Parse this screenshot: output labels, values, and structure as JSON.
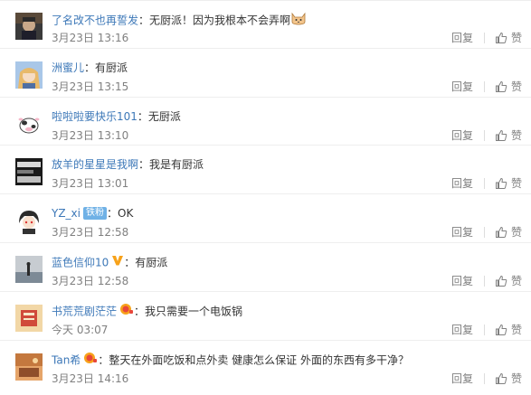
{
  "comments": [
    {
      "username": "了名改不也再誓发",
      "separator": "：",
      "text": "无厨派！因为我根本不会弄啊",
      "time": "3月23日 13:16",
      "reply_label": "回复",
      "like_label": "赞",
      "avatar_icon": "avatar-dark-portrait",
      "emoji": "cat-emoji"
    },
    {
      "username": "洲蜜儿",
      "separator": "：",
      "text": "有厨派",
      "time": "3月23日 13:15",
      "reply_label": "回复",
      "like_label": "赞",
      "avatar_icon": "avatar-anime-girl"
    },
    {
      "username": "啦啦啦要快乐101",
      "separator": "：",
      "text": "无厨派",
      "time": "3月23日 13:10",
      "reply_label": "回复",
      "like_label": "赞",
      "avatar_icon": "avatar-cow-cartoon"
    },
    {
      "username": "放羊的星星是我啊",
      "separator": "：",
      "text": "我是有厨派",
      "time": "3月23日 13:01",
      "reply_label": "回复",
      "like_label": "赞",
      "avatar_icon": "avatar-black-white-photo"
    },
    {
      "username": "YZ_xi",
      "badge": "铁粉",
      "separator": "：",
      "text": "OK",
      "time": "3月23日 12:58",
      "reply_label": "回复",
      "like_label": "赞",
      "avatar_icon": "avatar-anime-boy"
    },
    {
      "username": "蓝色信仰10",
      "vip": true,
      "separator": "：",
      "text": "有厨派",
      "time": "3月23日 12:58",
      "reply_label": "回复",
      "like_label": "赞",
      "avatar_icon": "avatar-silhouette-sea"
    },
    {
      "username": "书荒荒剧茫茫",
      "separator": "：",
      "text": "我只需要一个电饭锅",
      "time": "今天 03:07",
      "reply_label": "回复",
      "like_label": "赞",
      "avatar_icon": "avatar-red-book",
      "member_icon": "member-badge-icon"
    },
    {
      "username": "Tan希",
      "separator": "：",
      "text": "整天在外面吃饭和点外卖 健康怎么保证 外面的东西有多干净？",
      "time": "3月23日 14:16",
      "reply_label": "回复",
      "like_label": "赞",
      "avatar_icon": "avatar-orange-scene",
      "member_icon": "member-badge-icon"
    }
  ],
  "colors": {
    "username": "#3d78b8",
    "text": "#333333",
    "meta": "#808080",
    "divider": "#eeeeee",
    "badge_bg": "#6fb1e6",
    "vip": "#f7a21a"
  }
}
